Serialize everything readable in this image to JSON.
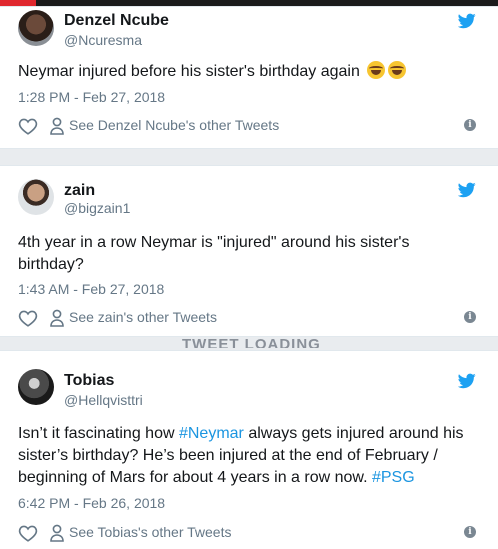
{
  "overlay": {
    "loading_label": "TWEET LOADING"
  },
  "colors": {
    "brand": "#1da1f2",
    "hashtag": "#1b95e0",
    "muted": "#657786",
    "top_accent": "#e0282e"
  },
  "tweets": [
    {
      "name": "Denzel Ncube",
      "handle": "@Ncuresma",
      "text": "Neymar injured before his sister's birthday again",
      "emoji": [
        "face-with-tears-of-joy",
        "face-with-tears-of-joy"
      ],
      "time": "1:28 PM - Feb 27, 2018",
      "see_other": "See Denzel Ncube's other Tweets"
    },
    {
      "name": "zain",
      "handle": "@bigzain1",
      "text": "4th year in a row Neymar is \"injured\" around his sister's birthday?",
      "time": "1:43 AM - Feb 27, 2018",
      "see_other": "See zain's other Tweets"
    },
    {
      "name": "Tobias",
      "handle": "@Hellqvisttri",
      "text_parts": {
        "a": "Isn’t it fascinating how ",
        "tag1": "#Neymar",
        "b": " always gets injured around his sister’s birthday? He’s been injured at the end of February / beginning of Mars for about 4 years in a row now. ",
        "tag2": "#PSG"
      },
      "time": "6:42 PM - Feb 26, 2018",
      "see_other": "See Tobias's other Tweets"
    }
  ],
  "icons": {
    "brand": "twitter-bird-icon",
    "like": "heart-icon",
    "profile": "person-icon",
    "info": "info-icon"
  },
  "info_glyph": "i"
}
